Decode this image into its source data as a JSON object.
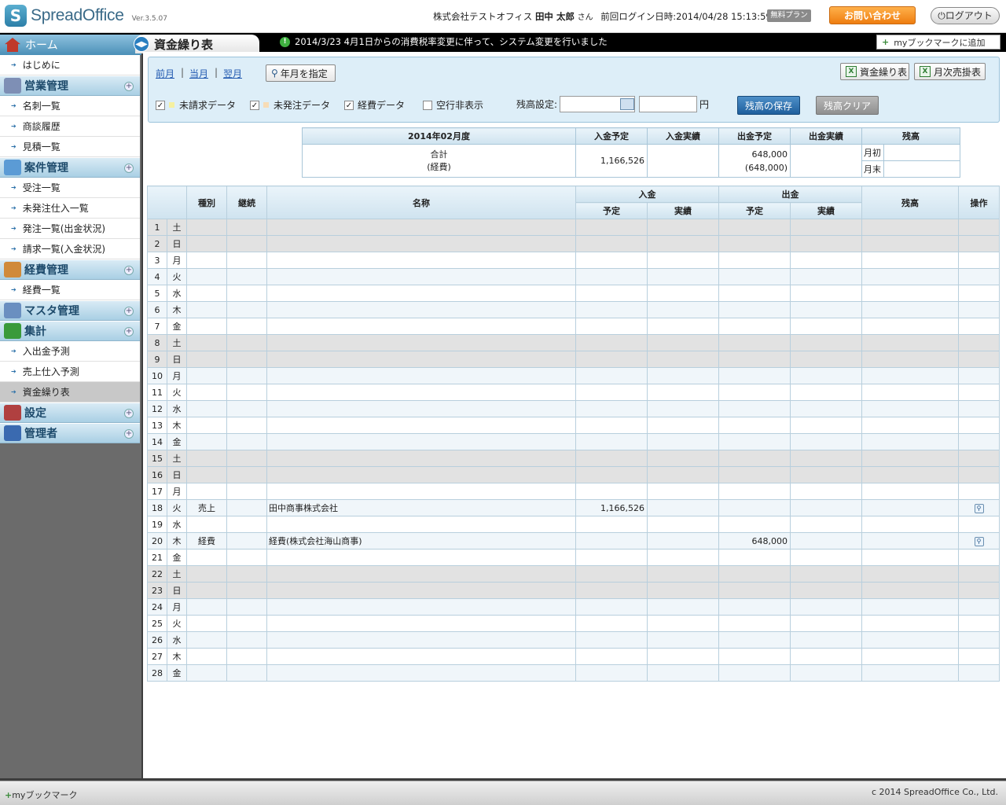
{
  "header": {
    "app_name": "SpreadOffice",
    "logo_letter": "S",
    "version": "Ver.3.5.07",
    "company": "株式会社テストオフィス",
    "user_name": "田中 太郎",
    "user_suffix": "さん",
    "last_login": "前回ログイン日時:2014/04/28 15:13:59",
    "plan": "無料プラン",
    "contact": "お問い合わせ",
    "logout": "ログアウト"
  },
  "nav": {
    "home": "ホーム",
    "page_title": "資金繰り表",
    "notice": "2014/3/23 4月1日からの消費税率変更に伴って、システム変更を行いました",
    "bookmark_add": "myブックマークに追加"
  },
  "sidebar": {
    "top_item": "はじめに",
    "sections": [
      {
        "label": "営業管理",
        "items": [
          "名刺一覧",
          "商談履歴",
          "見積一覧"
        ]
      },
      {
        "label": "案件管理",
        "items": [
          "受注一覧",
          "未発注仕入一覧",
          "発注一覧(出金状況)",
          "請求一覧(入金状況)"
        ]
      },
      {
        "label": "経費管理",
        "items": [
          "経費一覧"
        ]
      },
      {
        "label": "マスタ管理",
        "items": []
      },
      {
        "label": "集計",
        "items": [
          "入出金予測",
          "売上仕入予測",
          "資金繰り表"
        ]
      },
      {
        "label": "設定",
        "items": []
      },
      {
        "label": "管理者",
        "items": []
      }
    ],
    "active_item": "資金繰り表"
  },
  "filter": {
    "prev": "前月",
    "current": "当月",
    "next": "翌月",
    "pick_month": "年月を指定",
    "export_cash": "資金繰り表",
    "export_monthly": "月次売掛表",
    "cb_unbilled": "未請求データ",
    "cb_unordered": "未発注データ",
    "cb_expense": "経費データ",
    "cb_hide_empty": "空行非表示",
    "balance_label": "残高設定:",
    "yen": "円",
    "save": "残高の保存",
    "clear": "残高クリア",
    "colors": {
      "unbilled": "#f5f0a0",
      "unordered": "#f7dcb6"
    }
  },
  "summary": {
    "period": "2014年02月度",
    "h_in_plan": "入金予定",
    "h_in_actual": "入金実績",
    "h_out_plan": "出金予定",
    "h_out_actual": "出金実績",
    "h_balance": "残高",
    "label_total": "合計",
    "label_expense": "(経費)",
    "in_plan": "1,166,526",
    "out_plan": "648,000",
    "out_plan_expense": "(648,000)",
    "month_start": "月初",
    "month_end": "月末"
  },
  "table": {
    "h_type": "種別",
    "h_cont": "継続",
    "h_name": "名称",
    "h_in": "入金",
    "h_out": "出金",
    "h_plan": "予定",
    "h_actual": "実績",
    "h_balance": "残高",
    "h_ops": "操作",
    "rows": [
      {
        "d": "1",
        "w": "土"
      },
      {
        "d": "2",
        "w": "日"
      },
      {
        "d": "3",
        "w": "月"
      },
      {
        "d": "4",
        "w": "火"
      },
      {
        "d": "5",
        "w": "水"
      },
      {
        "d": "6",
        "w": "木"
      },
      {
        "d": "7",
        "w": "金"
      },
      {
        "d": "8",
        "w": "土"
      },
      {
        "d": "9",
        "w": "日"
      },
      {
        "d": "10",
        "w": "月"
      },
      {
        "d": "11",
        "w": "火"
      },
      {
        "d": "12",
        "w": "水"
      },
      {
        "d": "13",
        "w": "木"
      },
      {
        "d": "14",
        "w": "金"
      },
      {
        "d": "15",
        "w": "土"
      },
      {
        "d": "16",
        "w": "日"
      },
      {
        "d": "17",
        "w": "月"
      },
      {
        "d": "18",
        "w": "火",
        "type": "売上",
        "name": "田中商事株式会社",
        "in_plan": "1,166,526",
        "op": true
      },
      {
        "d": "19",
        "w": "水"
      },
      {
        "d": "20",
        "w": "木",
        "type": "経費",
        "name": "経費(株式会社海山商事)",
        "out_plan": "648,000",
        "op": true
      },
      {
        "d": "21",
        "w": "金"
      },
      {
        "d": "22",
        "w": "土"
      },
      {
        "d": "23",
        "w": "日"
      },
      {
        "d": "24",
        "w": "月"
      },
      {
        "d": "25",
        "w": "火"
      },
      {
        "d": "26",
        "w": "水"
      },
      {
        "d": "27",
        "w": "木"
      },
      {
        "d": "28",
        "w": "金"
      }
    ]
  },
  "footer": {
    "bookmark": "myブックマーク",
    "copyright": "c 2014 SpreadOffice Co., Ltd."
  }
}
